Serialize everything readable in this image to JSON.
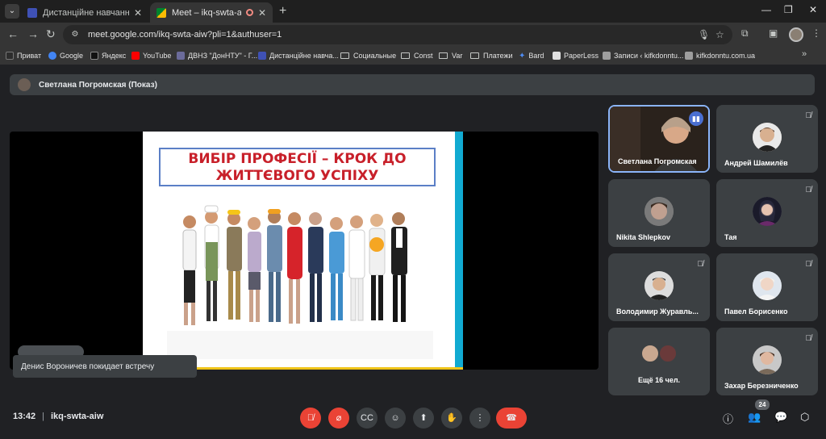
{
  "browser": {
    "tabs": [
      {
        "title": "Дистанційне навчання в ВСП ",
        "active": false
      },
      {
        "title": "Meet – ikq-swta-aiw",
        "active": true
      }
    ],
    "url": "meet.google.com/ikq-swta-aiw?pli=1&authuser=1",
    "bookmarks": [
      {
        "label": "Приват",
        "kind": "site",
        "color": "#2d2d2d"
      },
      {
        "label": "Google",
        "kind": "site",
        "color": "#4285f4"
      },
      {
        "label": "Яндекс",
        "kind": "site",
        "color": "#111111"
      },
      {
        "label": "YouTube",
        "kind": "site",
        "color": "#ff0000"
      },
      {
        "label": "ДВНЗ \"ДонНТУ\" - Г...",
        "kind": "site",
        "color": "#6b6b9a"
      },
      {
        "label": "Дистанційне навча...",
        "kind": "site",
        "color": "#3f51b5"
      },
      {
        "label": "Социальные",
        "kind": "folder"
      },
      {
        "label": "Const",
        "kind": "folder"
      },
      {
        "label": "Var",
        "kind": "folder"
      },
      {
        "label": "Платежи",
        "kind": "folder"
      },
      {
        "label": "Bard",
        "kind": "site",
        "color": "#4f8df5"
      },
      {
        "label": "PaperLess",
        "kind": "site",
        "color": "#e0e0e0"
      },
      {
        "label": "Записи ‹ kifkdonntu...",
        "kind": "site",
        "color": "#9e9e9e"
      },
      {
        "label": "kifkdonntu.com.ua",
        "kind": "site",
        "color": "#9e9e9e"
      }
    ]
  },
  "meet": {
    "presenter_banner": "Светлана Погромская (Показ)",
    "slide_title": "ВИБІР ПРОФЕСІЇ – КРОК ДО ЖИТТЄВОГО УСПІХУ",
    "participants": [
      {
        "name": "Светлана Погромская",
        "muted": false,
        "speaking": true
      },
      {
        "name": "Андрей Шамилёв",
        "muted": true
      },
      {
        "name": "Nikita Shlepkov",
        "muted": false
      },
      {
        "name": "Тая",
        "muted": true
      },
      {
        "name": "Володимир Журавль...",
        "muted": true
      },
      {
        "name": "Павел Борисенко",
        "muted": true
      },
      {
        "name": "Ещё 16 чел.",
        "muted": false
      },
      {
        "name": "Захар Березниченко",
        "muted": true
      }
    ],
    "toast": "Денис Вороничев покидает встречу",
    "time": "13:42",
    "meeting_code": "ikq-swta-aiw",
    "participant_count": "24",
    "accent": "#8ab4f8",
    "danger": "#ea4335"
  }
}
